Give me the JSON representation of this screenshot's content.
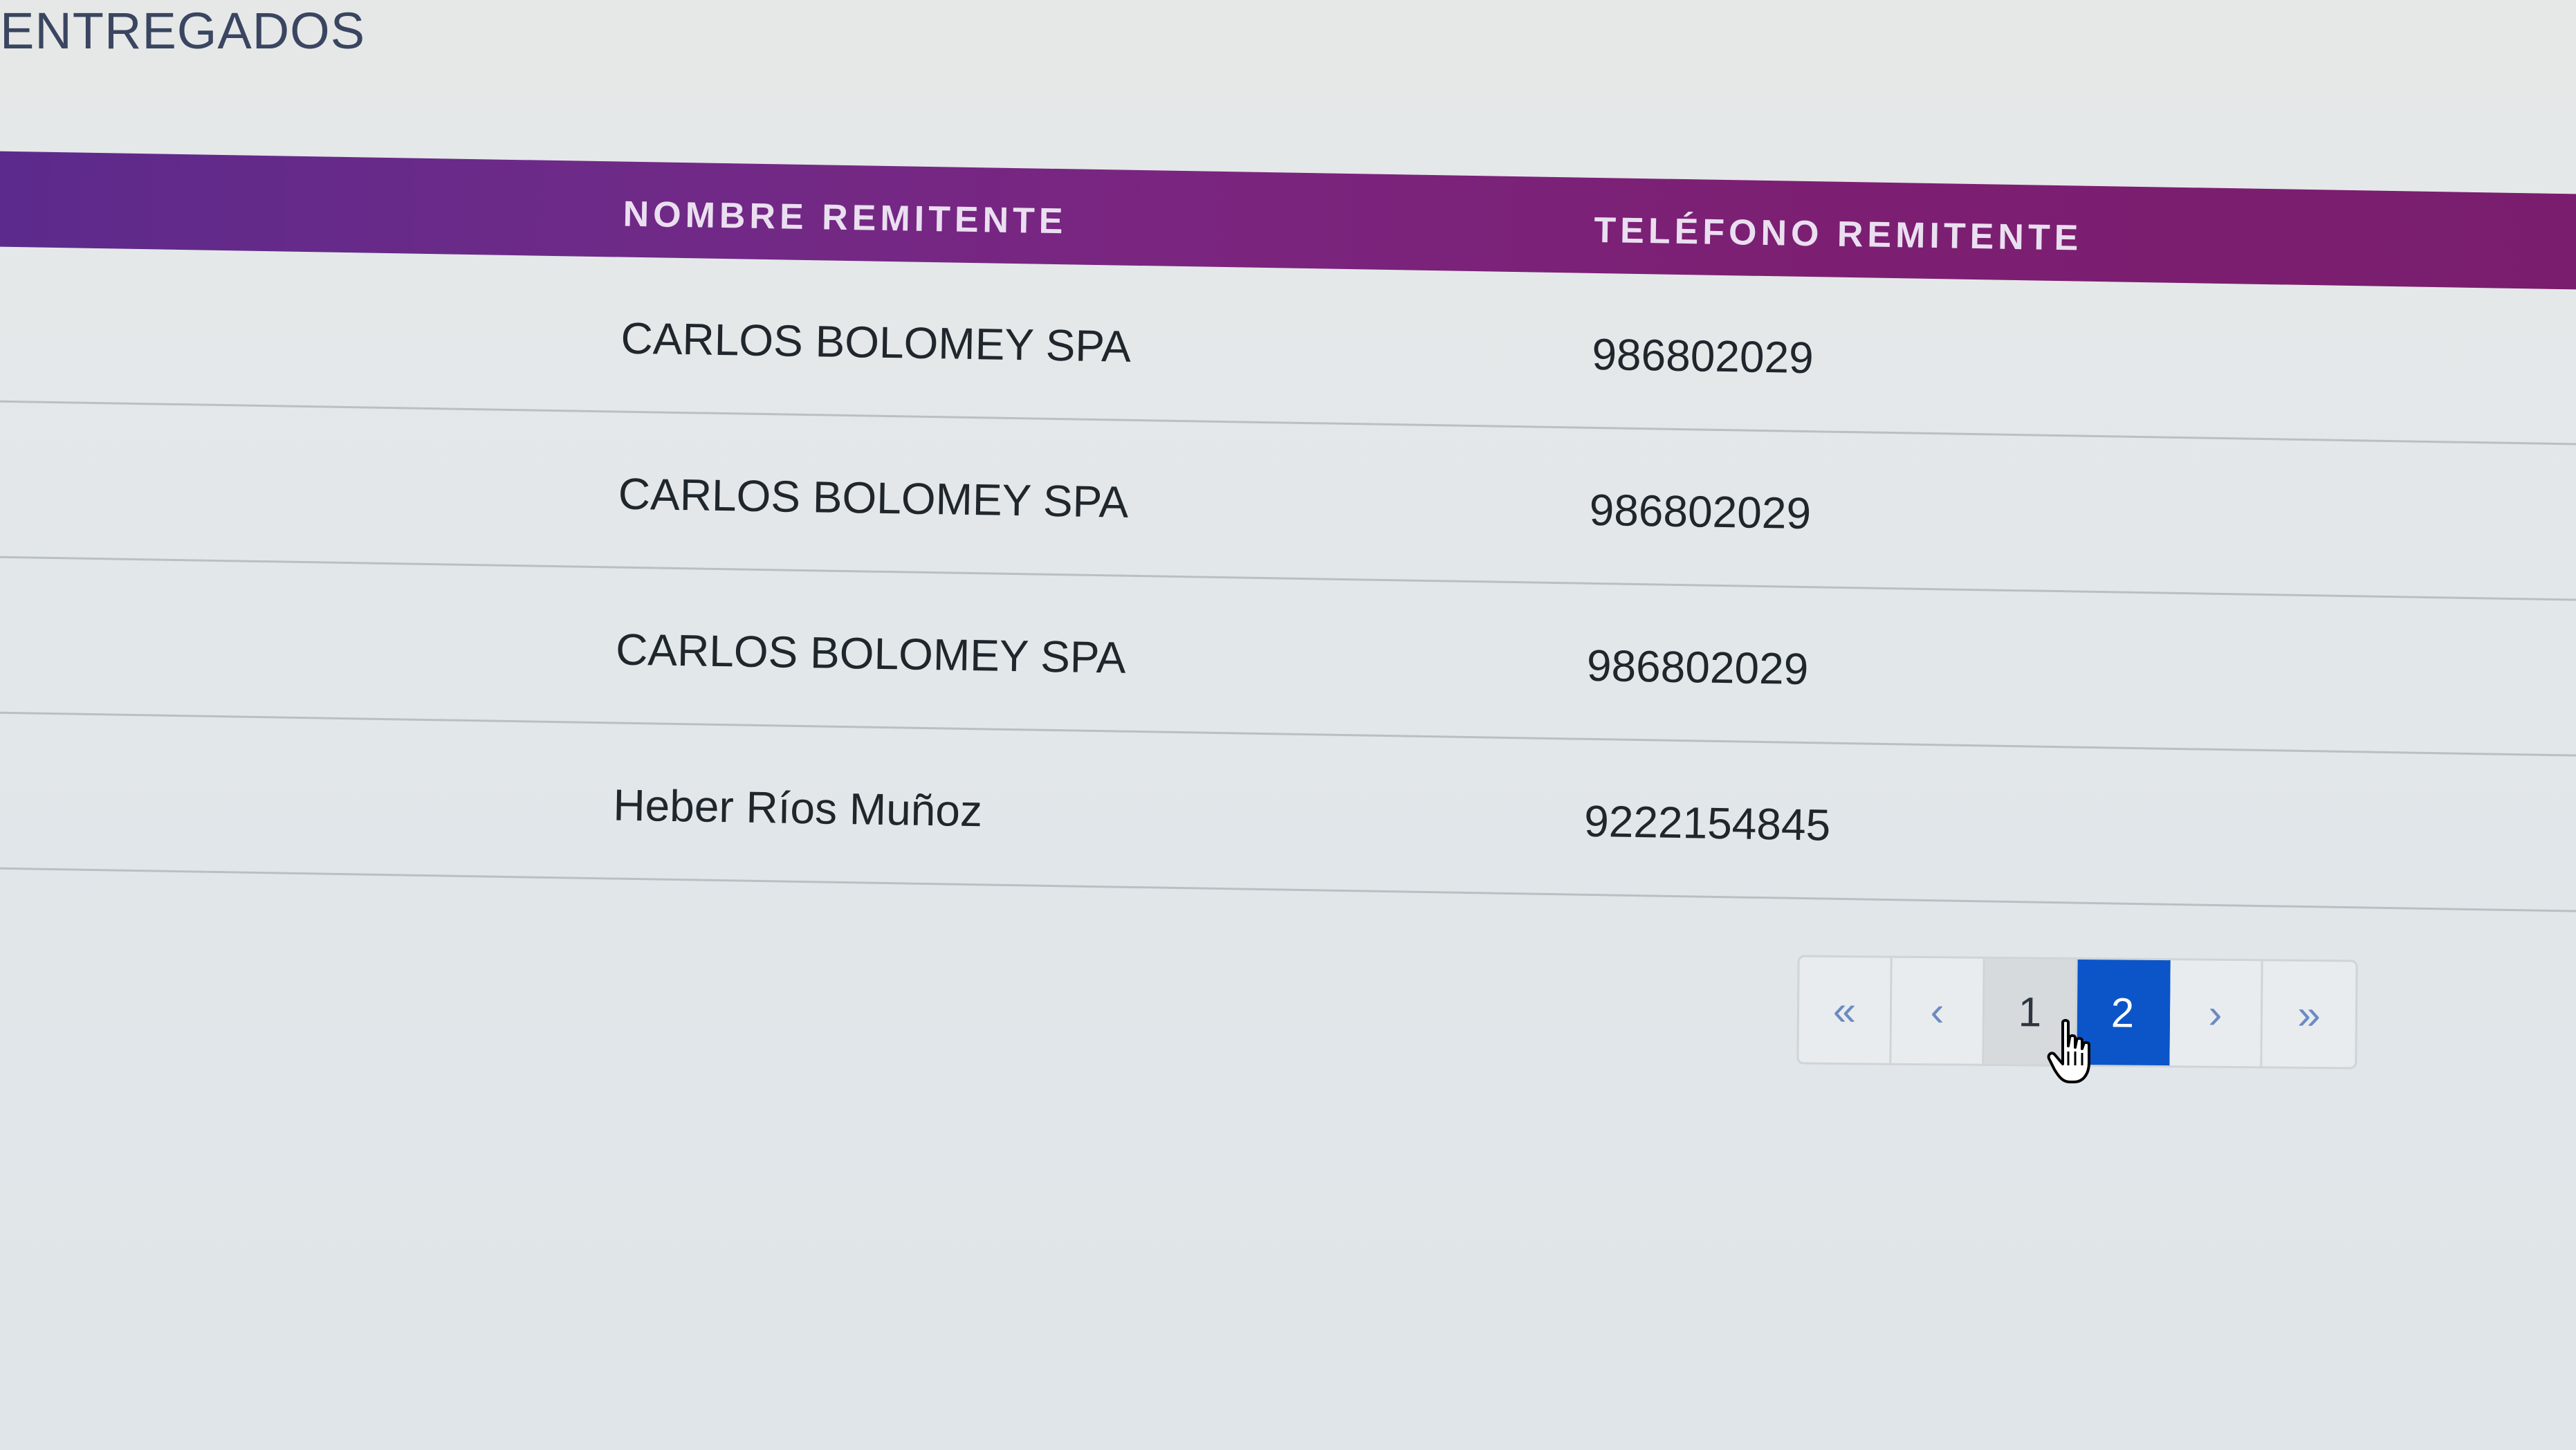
{
  "section": {
    "title": "ENTREGADOS"
  },
  "table": {
    "headers": {
      "name": "NOMBRE REMITENTE",
      "phone": "TELÉFONO REMITENTE"
    },
    "rows": [
      {
        "name": "CARLOS BOLOMEY SPA",
        "phone": "986802029"
      },
      {
        "name": "CARLOS BOLOMEY SPA",
        "phone": "986802029"
      },
      {
        "name": "CARLOS BOLOMEY SPA",
        "phone": "986802029"
      },
      {
        "name": "Heber Ríos Muñoz",
        "phone": "9222154845"
      }
    ]
  },
  "pagination": {
    "first": "«",
    "prev": "‹",
    "pages": [
      "1",
      "2"
    ],
    "current_page": "2",
    "next": "›",
    "last": "»"
  },
  "colors": {
    "header_gradient_start": "#5b2a8c",
    "header_gradient_end": "#7a1d6e",
    "active_page": "#0b55c9"
  },
  "icons": {
    "cursor": "hand-pointer-icon"
  }
}
